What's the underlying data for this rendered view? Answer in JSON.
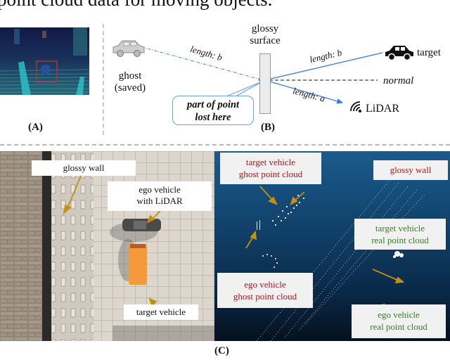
{
  "caption_fragment": "point cloud data for moving objects.",
  "panel_a": {
    "label": "(A)",
    "highlight_box_color": "#b0342c"
  },
  "panel_b": {
    "label": "(B)",
    "surface_label_line1": "glossy",
    "surface_label_line2": "surface",
    "ghost_label_line1": "ghost",
    "ghost_label_line2": "(saved)",
    "target_label": "target",
    "lidar_label": "LiDAR",
    "normal_label": "normal",
    "length_b_left": "length: b",
    "length_b_right": "length: b",
    "length_a": "length: a",
    "callout_line1": "part of point",
    "callout_line2": "lost here",
    "ray_color": "#3b7dd8",
    "icons": [
      "car-ghost-icon",
      "car-target-icon",
      "lidar-signal-icon"
    ]
  },
  "panel_c": {
    "label": "(C)",
    "photo_labels": {
      "glossy_wall": "glossy wall",
      "ego_line1": "ego vehicle",
      "ego_line2": "with LiDAR",
      "target": "target vehicle"
    },
    "cloud_labels": {
      "target_ghost_line1": "target vehicle",
      "target_ghost_line2": "ghost point cloud",
      "glossy_wall": "glossy wall",
      "target_real_line1": "target vehicle",
      "target_real_line2": "real point cloud",
      "ego_ghost_line1": "ego vehicle",
      "ego_ghost_line2": "ghost point cloud",
      "ego_real_line1": "ego vehicle",
      "ego_real_line2": "real point cloud"
    },
    "colors": {
      "arrow": "#c4900f",
      "ghost_text": "#b3141b",
      "real_text": "#3d7a2a",
      "target_vehicle": "#f59a3a"
    }
  }
}
